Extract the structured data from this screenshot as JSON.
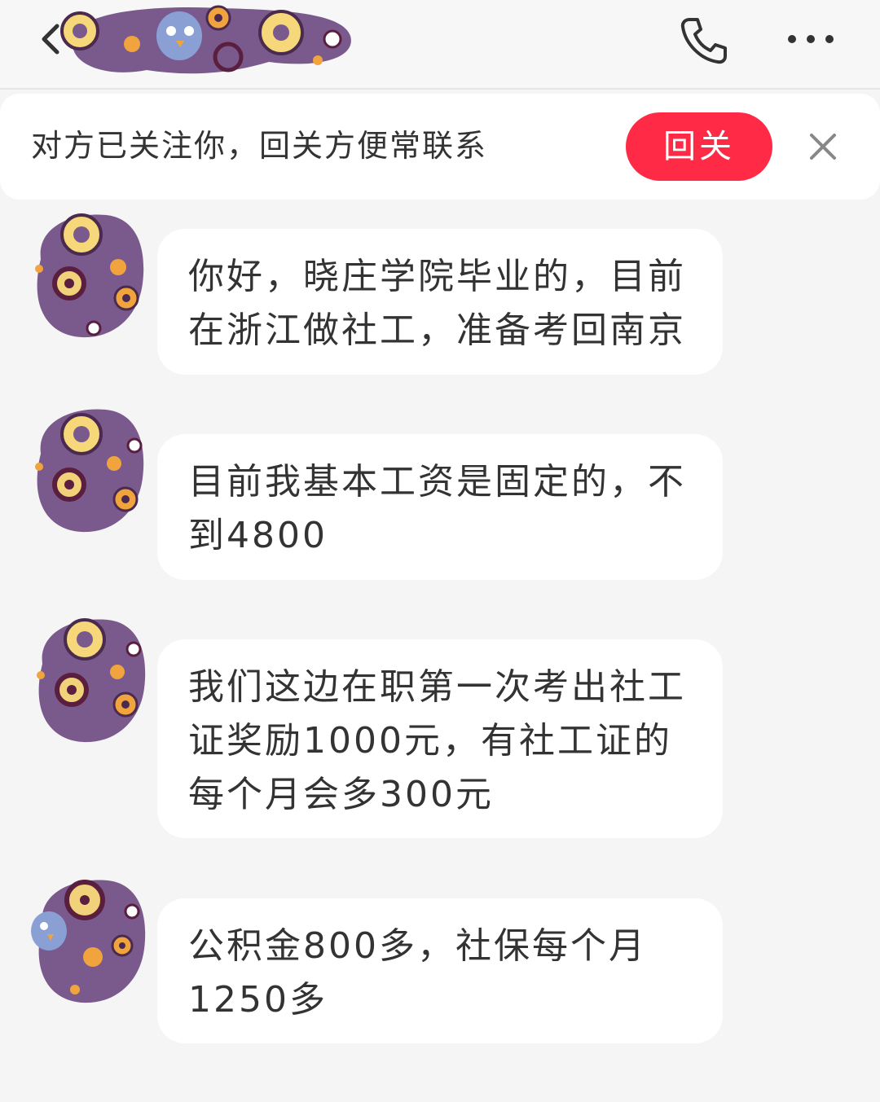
{
  "header": {
    "back_icon": "chevron-left-icon",
    "call_icon": "phone-icon",
    "more_icon": "more-dots-icon"
  },
  "follow_banner": {
    "message": "对方已关注你，回关方便常联系",
    "button_label": "回关",
    "close_icon": "close-icon",
    "button_color": "#ff2a46"
  },
  "messages": [
    {
      "text": "你好，晓庄学院毕业的，目前在浙江做社工，准备考回南京"
    },
    {
      "text": "目前我基本工资是固定的，不到4800"
    },
    {
      "text": "我们这边在职第一次考出社工证奖励1000元，有社工证的每个月会多300元"
    },
    {
      "text": "公积金800多，社保每个月1250多"
    }
  ],
  "colors": {
    "background": "#f5f5f5",
    "bubble": "#ffffff",
    "avatar_purple": "#7a5a8c",
    "accent_red": "#ff2a46"
  }
}
